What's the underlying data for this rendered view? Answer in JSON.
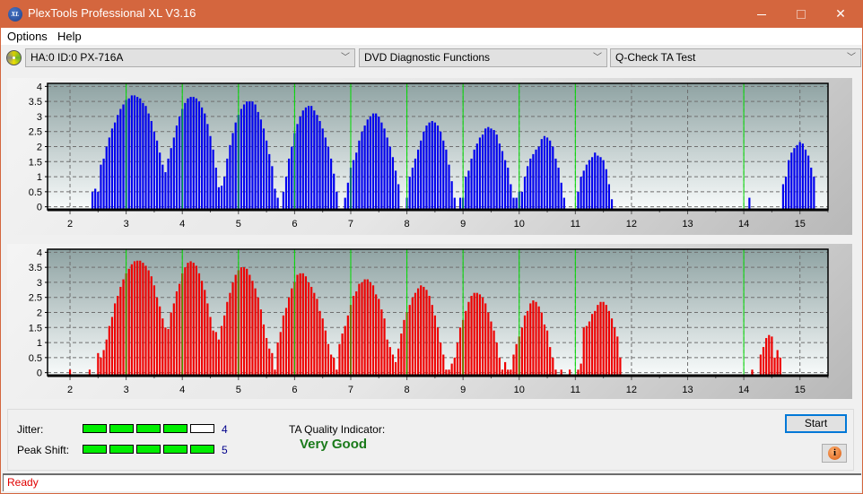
{
  "window": {
    "title": "PlexTools Professional XL V3.16",
    "app_icon_text": "XL",
    "minimize_icon": "minimize-icon",
    "maximize_icon": "maximize-icon",
    "close_icon": "close-icon",
    "close_glyph": "✕"
  },
  "menu": {
    "items": [
      "Options",
      "Help"
    ]
  },
  "toolbar": {
    "drive": "HA:0 ID:0  PX-716A",
    "function": "DVD Diagnostic Functions",
    "test": "Q-Check TA Test",
    "chevron": "﹀"
  },
  "colors": {
    "titlebar": "#d4663e",
    "top_bars": "#0000ee",
    "bottom_bars": "#ee0000",
    "marker_lines": "#00dd00",
    "meter_on": "#00ee00",
    "quality_text": "#1a7a1a",
    "status_text": "#e00000"
  },
  "chart_data": [
    {
      "type": "bar",
      "name": "top-chart",
      "title": "",
      "xlabel": "",
      "ylabel": "",
      "xlim": [
        1.6,
        15.5
      ],
      "ylim": [
        -0.1,
        4.1
      ],
      "xticks": [
        "2",
        "3",
        "4",
        "5",
        "6",
        "7",
        "8",
        "9",
        "10",
        "11",
        "12",
        "13",
        "14",
        "15"
      ],
      "yticks": [
        "4",
        "3.5",
        "3",
        "2.5",
        "2",
        "1.5",
        "1",
        "0.5",
        "0"
      ],
      "markers": [
        3,
        4,
        5,
        6,
        7,
        8,
        9,
        10,
        11,
        14
      ],
      "grid": true,
      "x_start": 2.3,
      "x_step": 0.05,
      "values": [
        0,
        0,
        0.5,
        0.6,
        0.5,
        1.4,
        1.6,
        2.0,
        2.3,
        2.6,
        2.8,
        3.05,
        3.25,
        3.4,
        3.55,
        3.6,
        3.7,
        3.7,
        3.65,
        3.6,
        3.45,
        3.35,
        3.1,
        2.85,
        2.5,
        2.2,
        1.8,
        1.4,
        1.15,
        1.6,
        1.95,
        2.3,
        2.7,
        3.0,
        3.25,
        3.45,
        3.6,
        3.65,
        3.65,
        3.6,
        3.5,
        3.3,
        3.1,
        2.75,
        2.35,
        1.9,
        1.3,
        0.65,
        0.7,
        1.0,
        1.6,
        2.05,
        2.45,
        2.8,
        3.05,
        3.25,
        3.4,
        3.5,
        3.5,
        3.5,
        3.4,
        3.15,
        2.9,
        2.6,
        2.2,
        1.75,
        1.35,
        0.6,
        0.3,
        0,
        0.5,
        1.0,
        1.6,
        2.0,
        2.45,
        2.75,
        3.0,
        3.2,
        3.3,
        3.35,
        3.35,
        3.2,
        3.05,
        2.85,
        2.6,
        2.3,
        2.0,
        1.6,
        1.1,
        0.5,
        0,
        0,
        0.3,
        0.8,
        1.3,
        1.55,
        1.8,
        2.2,
        2.5,
        2.7,
        2.9,
        3.0,
        3.1,
        3.1,
        3.0,
        2.8,
        2.6,
        2.3,
        2.0,
        1.65,
        1.2,
        0.75,
        0,
        0,
        0.3,
        1.0,
        1.3,
        1.6,
        1.9,
        2.2,
        2.5,
        2.7,
        2.8,
        2.85,
        2.8,
        2.7,
        2.5,
        2.2,
        1.9,
        1.4,
        0.85,
        0.3,
        0,
        0.3,
        0.3,
        1.0,
        1.2,
        1.6,
        1.9,
        2.1,
        2.3,
        2.4,
        2.6,
        2.65,
        2.6,
        2.55,
        2.4,
        2.1,
        1.85,
        1.55,
        1.3,
        0.75,
        0.3,
        0.3,
        0.5,
        0.5,
        1.0,
        1.35,
        1.6,
        1.75,
        1.9,
        2.0,
        2.25,
        2.35,
        2.3,
        2.2,
        2.0,
        1.6,
        1.3,
        0.8,
        0.3,
        0,
        0,
        0,
        0,
        0.5,
        1.0,
        1.2,
        1.4,
        1.55,
        1.65,
        1.8,
        1.7,
        1.65,
        1.55,
        1.25,
        0.75,
        0.25,
        0,
        0,
        0,
        0,
        0,
        0,
        0,
        0,
        0,
        0,
        0,
        0,
        0,
        0,
        0,
        0,
        0,
        0,
        0,
        0,
        0,
        0,
        0,
        0,
        0,
        0,
        0,
        0,
        0,
        0,
        0,
        0,
        0,
        0,
        0,
        0,
        0,
        0,
        0,
        0,
        0,
        0,
        0,
        0,
        0,
        0,
        0,
        0,
        0.3,
        0,
        0,
        0,
        0,
        0,
        0,
        0,
        0,
        0,
        0,
        0,
        0.75,
        1.0,
        1.55,
        1.8,
        1.95,
        2.05,
        2.15,
        2.1,
        1.9,
        1.7,
        1.3,
        1.0,
        0,
        0,
        0,
        0
      ]
    },
    {
      "type": "bar",
      "name": "bottom-chart",
      "title": "",
      "xlabel": "",
      "ylabel": "",
      "xlim": [
        1.6,
        15.5
      ],
      "ylim": [
        -0.1,
        4.1
      ],
      "xticks": [
        "2",
        "3",
        "4",
        "5",
        "6",
        "7",
        "8",
        "9",
        "10",
        "11",
        "12",
        "13",
        "14",
        "15"
      ],
      "yticks": [
        "4",
        "3.5",
        "3",
        "2.5",
        "2",
        "1.5",
        "1",
        "0.5",
        "0"
      ],
      "markers": [
        3,
        4,
        5,
        6,
        7,
        8,
        9,
        10,
        11,
        14
      ],
      "grid": true,
      "x_start": 2.0,
      "x_step": 0.05,
      "values": [
        0.1,
        0,
        0,
        0,
        0,
        0,
        0,
        0.1,
        0,
        0,
        0.65,
        0.5,
        0.75,
        1.1,
        1.55,
        1.85,
        2.3,
        2.55,
        2.85,
        3.1,
        3.3,
        3.45,
        3.6,
        3.7,
        3.72,
        3.72,
        3.65,
        3.55,
        3.4,
        3.2,
        2.9,
        2.5,
        2.2,
        1.8,
        1.5,
        1.45,
        2.0,
        2.3,
        2.7,
        2.95,
        3.3,
        3.5,
        3.65,
        3.7,
        3.65,
        3.55,
        3.3,
        3.05,
        2.75,
        2.3,
        1.85,
        1.4,
        1.35,
        1.1,
        1.55,
        1.9,
        2.35,
        2.65,
        3.0,
        3.25,
        3.4,
        3.5,
        3.5,
        3.45,
        3.25,
        3.05,
        2.8,
        2.5,
        2.1,
        1.6,
        1.15,
        0.8,
        0.65,
        0.1,
        1.0,
        1.35,
        1.9,
        2.15,
        2.5,
        2.8,
        3.0,
        3.25,
        3.3,
        3.3,
        3.2,
        3.0,
        2.85,
        2.65,
        2.45,
        2.05,
        1.8,
        1.4,
        0.95,
        0.6,
        0.5,
        0.1,
        0.95,
        1.3,
        1.55,
        1.9,
        2.25,
        2.55,
        2.7,
        2.95,
        3.0,
        3.1,
        3.1,
        3.0,
        2.9,
        2.6,
        2.45,
        2.1,
        1.8,
        1.1,
        0.85,
        0.6,
        0.35,
        0.8,
        1.3,
        1.75,
        2.0,
        2.25,
        2.5,
        2.65,
        2.8,
        2.9,
        2.85,
        2.75,
        2.55,
        2.25,
        1.9,
        1.5,
        1.0,
        0.6,
        0.1,
        0.1,
        0.3,
        0.5,
        1.0,
        1.5,
        1.75,
        2.05,
        2.35,
        2.55,
        2.65,
        2.65,
        2.6,
        2.5,
        2.3,
        2.0,
        1.7,
        1.4,
        1.0,
        0.5,
        0.1,
        0.35,
        0.1,
        0.1,
        0.6,
        0.95,
        1.2,
        1.5,
        1.9,
        2.05,
        2.3,
        2.4,
        2.35,
        2.2,
        2.0,
        1.6,
        1.4,
        0.85,
        0.5,
        0.1,
        0,
        0.1,
        0,
        0,
        0.1,
        0,
        0,
        0.1,
        0.3,
        1.5,
        1.55,
        1.7,
        1.95,
        2.05,
        2.25,
        2.35,
        2.35,
        2.25,
        2.05,
        1.8,
        1.5,
        1.2,
        0.5,
        0,
        0,
        0,
        0,
        0,
        0,
        0,
        0,
        0,
        0,
        0,
        0,
        0,
        0,
        0,
        0,
        0,
        0,
        0,
        0,
        0,
        0,
        0,
        0,
        0,
        0,
        0,
        0,
        0,
        0,
        0,
        0,
        0,
        0,
        0,
        0,
        0,
        0,
        0,
        0,
        0,
        0,
        0,
        0,
        0,
        0,
        0.1,
        0,
        0,
        0.6,
        0.85,
        1.15,
        1.25,
        1.2,
        0.5,
        0.75,
        0.5
      ]
    }
  ],
  "metrics": {
    "jitter_label": "Jitter:",
    "jitter_value": 4,
    "jitter_max": 5,
    "jitter_text": "4",
    "peak_shift_label": "Peak Shift:",
    "peak_shift_value": 5,
    "peak_shift_max": 5,
    "peak_shift_text": "5",
    "quality_label": "TA Quality Indicator:",
    "quality_value": "Very Good"
  },
  "buttons": {
    "start": "Start",
    "info_glyph": "i"
  },
  "status": {
    "text": "Ready"
  }
}
